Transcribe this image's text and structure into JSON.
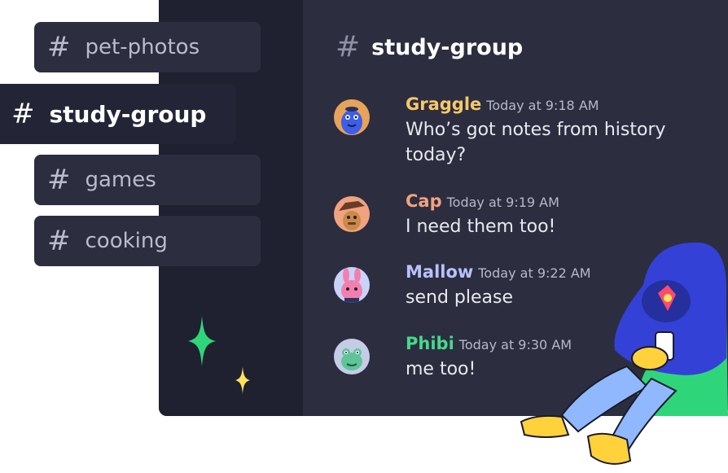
{
  "channel_list": [
    {
      "label": "pet-photos",
      "active": false
    },
    {
      "label": "study-group",
      "active": true
    },
    {
      "label": "games",
      "active": false
    },
    {
      "label": "cooking",
      "active": false
    }
  ],
  "header": {
    "hash": "#",
    "title": "study-group"
  },
  "messages": [
    {
      "author": "Graggle",
      "time": "Today at 9:18 AM",
      "text": "Who’s got notes from history today?",
      "color": "#f5c96b",
      "avatar": "blue-creature-avatar"
    },
    {
      "author": "Cap",
      "time": "Today at 9:19 AM",
      "text": "I need them too!",
      "color": "#f0a37f",
      "avatar": "hat-creature-avatar"
    },
    {
      "author": "Mallow",
      "time": "Today at 9:22 AM",
      "text": "send please",
      "color": "#b8c1ff",
      "avatar": "pink-bunny-avatar"
    },
    {
      "author": "Phibi",
      "time": "Today at 9:30 AM",
      "text": "me too!",
      "color": "#46d98b",
      "avatar": "frog-avatar"
    }
  ],
  "colors": {
    "window_bg": "#2c2d3f",
    "side_bg": "#1f2030",
    "accent_green": "#2fd679",
    "accent_yellow": "#ffe35a"
  }
}
